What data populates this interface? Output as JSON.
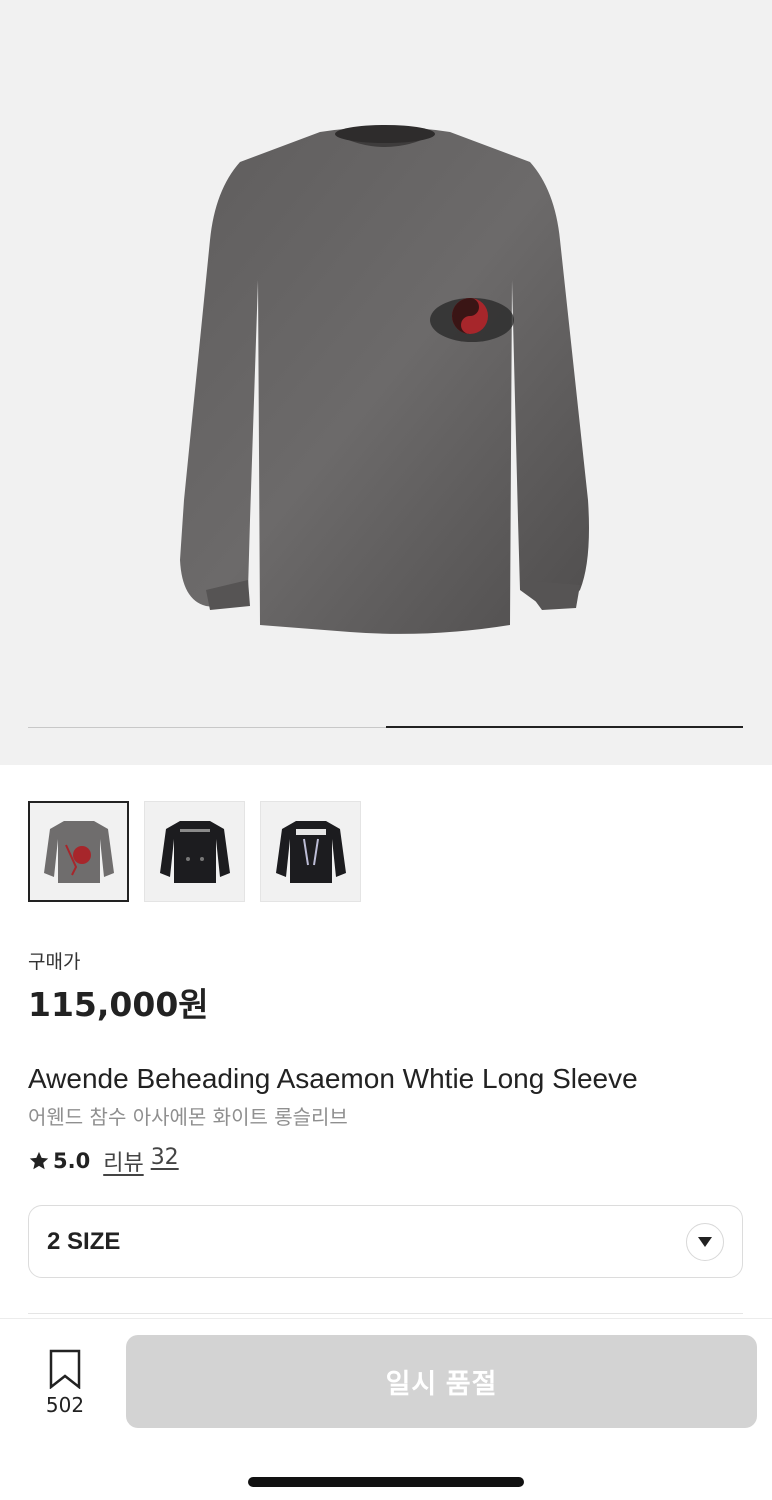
{
  "gallery": {
    "progress": 0.5,
    "thumbnails": [
      {
        "label": "thumbnail-front-gray",
        "selected": true
      },
      {
        "label": "thumbnail-back-black-1",
        "selected": false
      },
      {
        "label": "thumbnail-back-black-2",
        "selected": false
      }
    ]
  },
  "product": {
    "price_label": "구매가",
    "price": "115,000원",
    "name_en": "Awende Beheading Asaemon Whtie Long Sleeve",
    "name_ko": "어웬드 참수 아사에몬 화이트 롱슬리브",
    "rating": "5.0",
    "review_label": "리뷰",
    "review_count": "32"
  },
  "size_select": {
    "value": "2 SIZE",
    "icon": "chevron-down-icon"
  },
  "bottom_bar": {
    "wishlist_count": "502",
    "wishlist_icon": "bookmark-icon",
    "buy_button_label": "일시 품절"
  },
  "colors": {
    "accent": "#222222",
    "disabled_button": "#d3d3d3",
    "hero_bg": "#f1f1f1"
  }
}
